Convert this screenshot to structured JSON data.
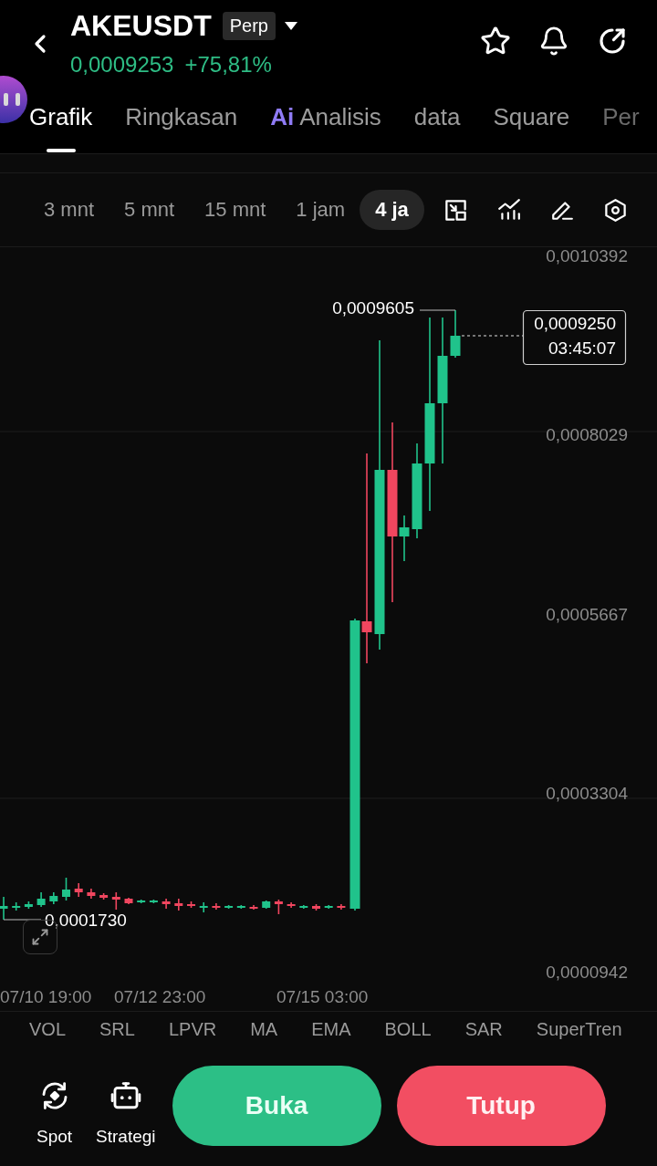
{
  "header": {
    "symbol": "AKEUSDT",
    "badge": "Perp",
    "price": "0,0009253",
    "change": "+75,81%"
  },
  "tabs": [
    {
      "label": "Grafik",
      "selected": true
    },
    {
      "label": "Ringkasan",
      "selected": false
    },
    {
      "label": "Analisis",
      "badge": "Ai",
      "selected": false
    },
    {
      "label": "data",
      "selected": false
    },
    {
      "label": "Square",
      "selected": false
    },
    {
      "label": "Per",
      "selected": false
    }
  ],
  "intervals": [
    {
      "label": "3 mnt",
      "selected": false
    },
    {
      "label": "5 mnt",
      "selected": false
    },
    {
      "label": "15 mnt",
      "selected": false
    },
    {
      "label": "1 jam",
      "selected": false
    },
    {
      "label": "4 ja",
      "selected": true
    }
  ],
  "chart": {
    "price_scale": [
      "0,0010392",
      "0,0008029",
      "0,0005667",
      "0,0003304",
      "0,0000942"
    ],
    "time_scale": [
      "07/10 19:00",
      "07/12 23:00",
      "07/15 03:00"
    ],
    "high_label": "0,0009605",
    "low_label": "0,0001730",
    "last_price": "0,0009250",
    "countdown": "03:45:07"
  },
  "indicators": [
    "VOL",
    "SRL",
    "LPVR",
    "MA",
    "EMA",
    "BOLL",
    "SAR",
    "SuperTren"
  ],
  "bottom_bar": {
    "shortcuts": [
      {
        "label": "Spot",
        "kind": "spot"
      },
      {
        "label": "Strategi",
        "kind": "robot"
      }
    ],
    "buttons": [
      {
        "label": "Buka",
        "kind": "buy"
      },
      {
        "label": "Tutup",
        "kind": "sell"
      }
    ]
  }
}
